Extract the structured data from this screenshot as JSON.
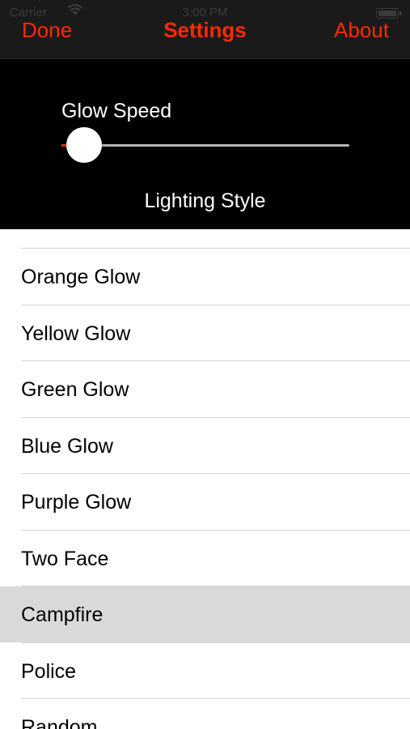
{
  "status_bar": {
    "carrier": "Carrier",
    "time": "3:00 PM"
  },
  "navbar": {
    "left_button": "Done",
    "title": "Settings",
    "right_button": "About"
  },
  "settings": {
    "slider_label": "Glow Speed",
    "slider_value_fraction": 0.0,
    "section_title": "Lighting Style"
  },
  "lighting_styles": {
    "items": [
      "Orange Glow",
      "Yellow Glow",
      "Green Glow",
      "Blue Glow",
      "Purple Glow",
      "Two Face",
      "Campfire",
      "Police",
      "Random"
    ],
    "selected": "Campfire"
  },
  "colors": {
    "accent": "#ff2a00",
    "navbar_bg": "#1a1a1a",
    "panel_bg": "#000000",
    "selected_row_bg": "#d9d9d9"
  },
  "icons": [
    "wifi-icon",
    "battery-icon"
  ]
}
